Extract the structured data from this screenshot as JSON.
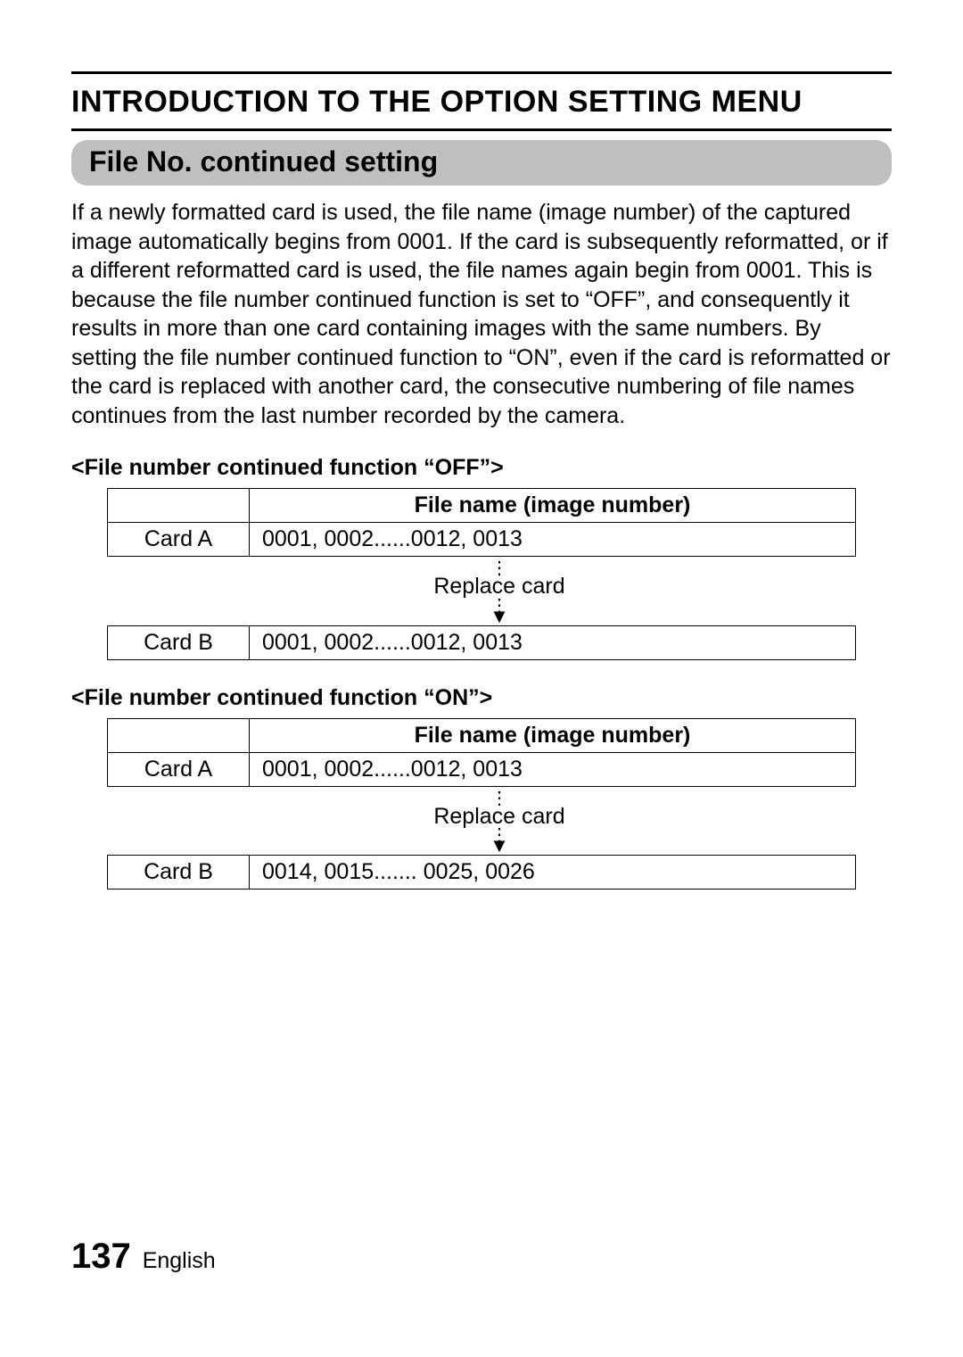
{
  "chapter_title": "INTRODUCTION TO THE OPTION SETTING MENU",
  "section_title": "File No. continued setting",
  "body_paragraph": "If a newly formatted card is used, the file name (image number) of the captured image automatically begins from 0001. If the card is subsequently reformatted, or if a different reformatted card is used, the file names again begin from 0001. This is because the file number continued function is set to “OFF”, and consequently it results in more than one card containing images with the same numbers. By setting the file number continued function to “ON”, even if the card is reformatted or the card is replaced with another card, the consecutive numbering of file names continues from the last number recorded by the camera.",
  "example_off": {
    "heading": "<File number continued function “OFF”>",
    "col_header": "File name (image number)",
    "rows": [
      {
        "card": "Card A",
        "values": "0001, 0002......0012, 0013"
      },
      {
        "card": "Card B",
        "values": "0001, 0002......0012, 0013"
      }
    ],
    "replace_label": "Replace card"
  },
  "example_on": {
    "heading": "<File number continued function “ON”>",
    "col_header": "File name (image number)",
    "rows": [
      {
        "card": "Card A",
        "values": "0001, 0002......0012, 0013"
      },
      {
        "card": "Card B",
        "values": "0014, 0015....... 0025, 0026"
      }
    ],
    "replace_label": "Replace card"
  },
  "footer": {
    "page_number": "137",
    "language": "English"
  }
}
